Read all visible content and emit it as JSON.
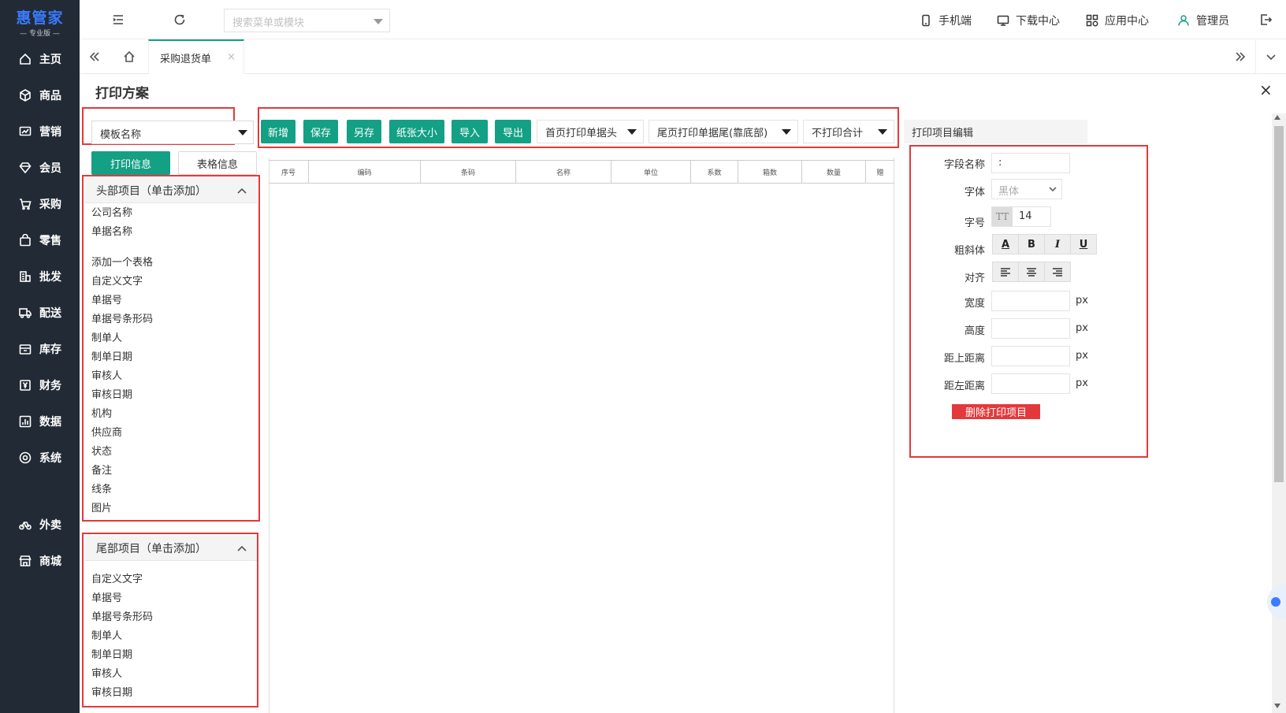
{
  "app": {
    "brand": "惠管家",
    "edition": "— 专业版 —"
  },
  "sidebar": {
    "items": [
      {
        "label": "主页",
        "icon": "home-icon"
      },
      {
        "label": "商品",
        "icon": "cube-icon"
      },
      {
        "label": "营销",
        "icon": "chart-icon"
      },
      {
        "label": "会员",
        "icon": "diamond-icon"
      },
      {
        "label": "采购",
        "icon": "cart-icon"
      },
      {
        "label": "零售",
        "icon": "bag-icon"
      },
      {
        "label": "批发",
        "icon": "building-icon"
      },
      {
        "label": "配送",
        "icon": "truck-icon"
      },
      {
        "label": "库存",
        "icon": "box-icon"
      },
      {
        "label": "财务",
        "icon": "yen-icon"
      },
      {
        "label": "数据",
        "icon": "bar-chart-icon"
      },
      {
        "label": "系统",
        "icon": "gear-icon"
      },
      {
        "label": "外卖",
        "icon": "bike-icon"
      },
      {
        "label": "商城",
        "icon": "store-icon"
      }
    ]
  },
  "topbar": {
    "search_placeholder": "搜索菜单或模块",
    "mobile": "手机端",
    "download": "下载中心",
    "apps": "应用中心",
    "user": "管理员"
  },
  "tabs": {
    "active": "采购退货单",
    "close": "×"
  },
  "dialog": {
    "title": "打印方案",
    "close": "×"
  },
  "left": {
    "template_select": "模板名称",
    "subtab_print": "打印信息",
    "subtab_table": "表格信息",
    "header_group": "头部项目（单击添加）",
    "header_items": [
      "公司名称",
      "单据名称",
      "添加一个表格",
      "自定义文字",
      "单据号",
      "单据号条形码",
      "制单人",
      "制单日期",
      "审核人",
      "审核日期",
      "机构",
      "供应商",
      "状态",
      "备注",
      "线条",
      "图片"
    ],
    "footer_group": "尾部项目（单击添加）",
    "footer_items": [
      "自定义文字",
      "单据号",
      "单据号条形码",
      "制单人",
      "制单日期",
      "审核人",
      "审核日期"
    ]
  },
  "toolbar": {
    "buttons": [
      "新增",
      "保存",
      "另存",
      "纸张大小",
      "导入",
      "导出"
    ],
    "header_dropdown": "首页打印单据头",
    "footer_dropdown": "尾页打印单据尾(靠底部)",
    "total_dropdown": "不打印合计"
  },
  "canvas": {
    "columns": [
      "序号",
      "编码",
      "条码",
      "名称",
      "单位",
      "系数",
      "箱数",
      "数量",
      "赠"
    ]
  },
  "right": {
    "title": "打印项目编辑",
    "field_name_label": "字段名称",
    "field_name_value": ":",
    "font_label": "字体",
    "font_value": "黑体",
    "size_label": "字号",
    "size_icon": "TT",
    "size_value": "14",
    "style_label": "粗斜体",
    "style_a": "A",
    "style_b": "B",
    "style_i": "I",
    "style_u": "U",
    "align_label": "对齐",
    "width_label": "宽度",
    "height_label": "高度",
    "top_label": "距上距离",
    "left_label": "距左距离",
    "unit": "px",
    "delete_button": "删除打印项目"
  }
}
